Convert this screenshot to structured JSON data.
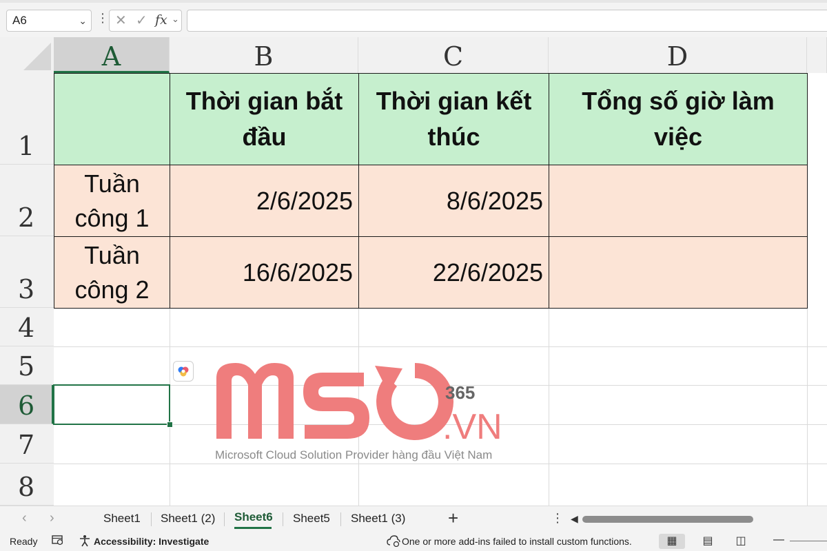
{
  "formula_bar": {
    "name_box": "A6",
    "cancel_glyph": "✕",
    "enter_glyph": "✓",
    "fx_label": "fx",
    "formula": ""
  },
  "columns": [
    "A",
    "B",
    "C",
    "D"
  ],
  "rows": [
    "1",
    "2",
    "3",
    "4",
    "5",
    "6",
    "7",
    "8"
  ],
  "table": {
    "header": {
      "a": "",
      "b": "Thời gian bắt đầu",
      "c": "Thời gian kết thúc",
      "d": "Tổng số giờ làm việc"
    },
    "rows": [
      {
        "label": "Tuần công 1",
        "start": "2/6/2025",
        "end": "8/6/2025",
        "total": ""
      },
      {
        "label": "Tuần công 2",
        "start": "16/6/2025",
        "end": "22/6/2025",
        "total": ""
      }
    ]
  },
  "watermark": {
    "logo": "MSO",
    "suffix": ".VN",
    "superscript": "365",
    "tagline": "Microsoft Cloud Solution Provider hàng đầu Việt Nam"
  },
  "sheet_tabs": [
    {
      "label": "Sheet1",
      "active": false
    },
    {
      "label": "Sheet1 (2)",
      "active": false
    },
    {
      "label": "Sheet6",
      "active": true
    },
    {
      "label": "Sheet5",
      "active": false
    },
    {
      "label": "Sheet1 (3)",
      "active": false
    }
  ],
  "status_bar": {
    "ready": "Ready",
    "accessibility": "Accessibility: Investigate",
    "message": "One or more add-ins failed to install custom functions."
  },
  "colors": {
    "header_fill": "#c6efce",
    "body_fill": "#fce4d6",
    "accent": "#217346",
    "watermark": "#ef7d7d"
  },
  "icons": {
    "namebox_dropdown": "chevron-down-icon",
    "cancel": "close-icon",
    "enter": "check-icon",
    "copilot": "copilot-icon",
    "add_sheet": "plus-icon",
    "macro": "macro-record-icon",
    "accessibility": "accessibility-icon",
    "addin_warning": "addin-warning-icon",
    "normal_view": "grid-view-icon",
    "page_layout": "page-layout-icon",
    "page_break": "page-break-icon"
  }
}
